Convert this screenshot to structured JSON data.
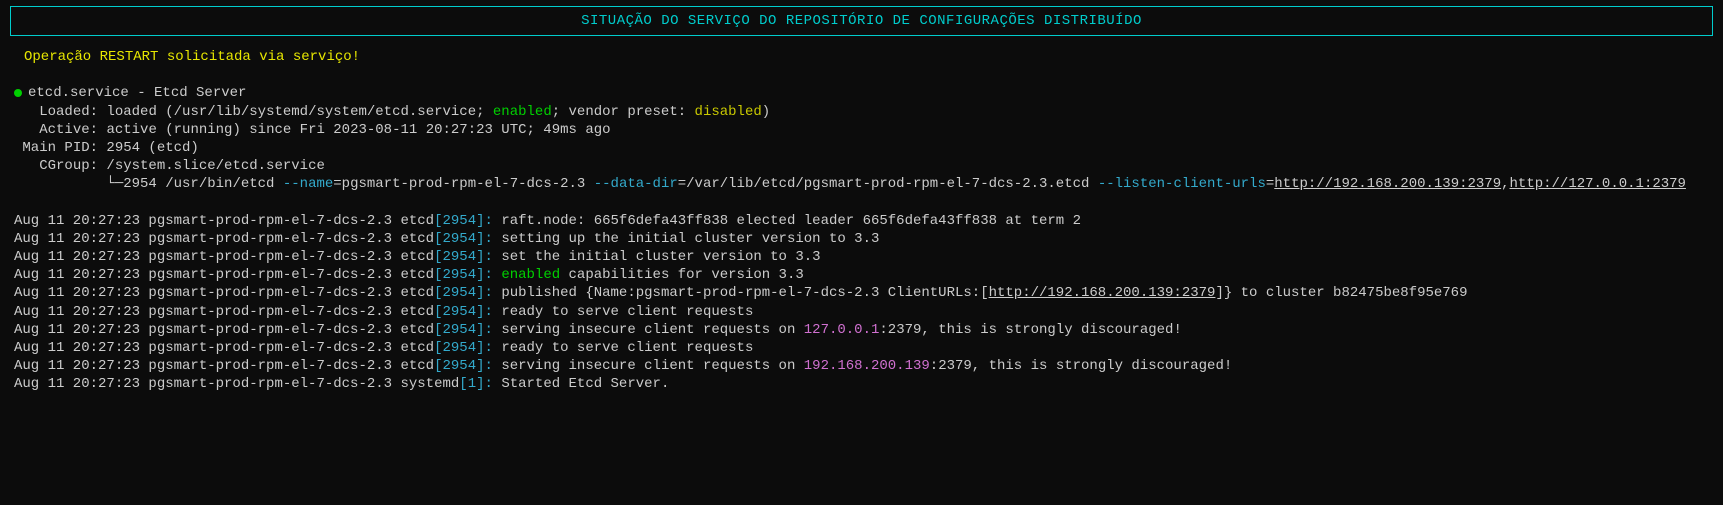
{
  "title": "SITUAÇÃO DO SERVIÇO DO REPOSITÓRIO DE CONFIGURAÇÕES DISTRIBUÍDO",
  "restart_msg": "Operação RESTART solicitada via serviço!",
  "svc": {
    "service_line": "etcd.service - Etcd Server",
    "loaded_label": "   Loaded: ",
    "loaded_before": "loaded (/usr/lib/systemd/system/etcd.service; ",
    "loaded_enabled": "enabled",
    "loaded_after": "; vendor preset: ",
    "loaded_disabled": "disabled",
    "loaded_tail": ")",
    "active_label": "   Active: ",
    "active_value": "active (running) since Fri 2023-08-11 20:27:23 UTC; 49ms ago",
    "mainpid_line": " Main PID: 2954 (etcd)",
    "cgroup_line": "   CGroup: /system.slice/etcd.service",
    "cgroup_tree_prefix": "           └─2954 /usr/bin/etcd ",
    "flag_name": "--name",
    "flag_name_val": "=pgsmart-prod-rpm-el-7-dcs-2.3 ",
    "flag_datadir": "--data-dir",
    "flag_datadir_val": "=/var/lib/etcd/pgsmart-prod-rpm-el-7-dcs-2.3.etcd ",
    "flag_listen": "--listen-client-urls",
    "flag_listen_eq": "=",
    "url1": "http://192.168.200.139:2379",
    "comma": ",",
    "url2": "http://127.0.0.1:2379"
  },
  "log": {
    "prefix": "Aug 11 20:27:23 pgsmart-prod-rpm-el-7-dcs-2.3 etcd",
    "prefix_sysd": "Aug 11 20:27:23 pgsmart-prod-rpm-el-7-dcs-2.3 systemd",
    "lb": "[",
    "pid_etcd": "2954",
    "pid_sysd": "1",
    "rb_colon": "]: ",
    "l1": "raft.node: 665f6defa43ff838 elected leader 665f6defa43ff838 at term 2",
    "l2": "setting up the initial cluster version to 3.3",
    "l3": "set the initial cluster version to 3.3",
    "l4_enabled": "enabled",
    "l4_rest": " capabilities for version 3.3",
    "l5_a": "published {Name:pgsmart-prod-rpm-el-7-dcs-2.3 ClientURLs:[",
    "l5_url": "http://192.168.200.139:2379",
    "l5_b": "]} to cluster b82475be8f95e769",
    "l6": "ready to serve client requests",
    "l7_a": "serving insecure client requests on ",
    "l7_ip": "127.0.0.1",
    "l7_b": ":2379, this is strongly discouraged!",
    "l8": "ready to serve client requests",
    "l9_a": "serving insecure client requests on ",
    "l9_ip": "192.168.200.139",
    "l9_b": ":2379, this is strongly discouraged!",
    "l10": "Started Etcd Server."
  }
}
